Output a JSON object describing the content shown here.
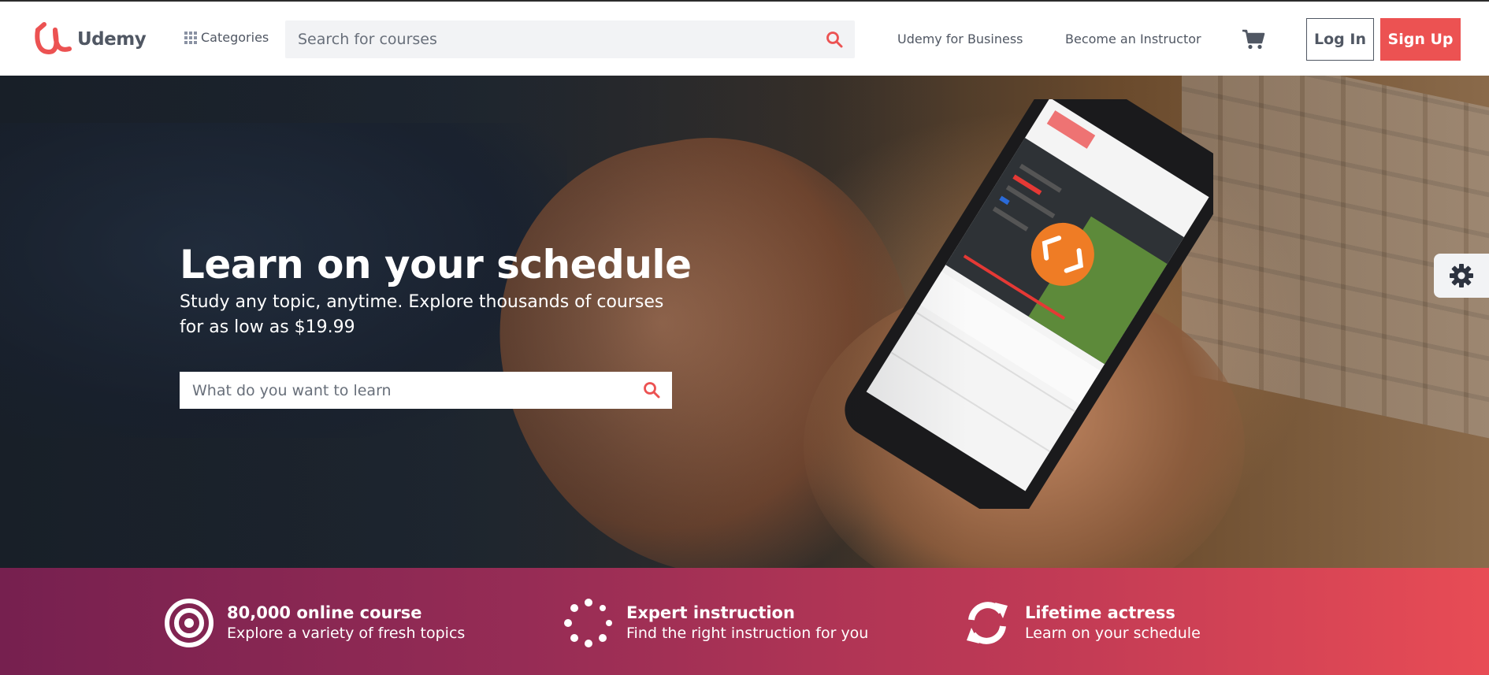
{
  "brand": {
    "name": "Udemy",
    "color": "#ec5252"
  },
  "header": {
    "categories_label": "Categories",
    "search_placeholder": "Search for courses",
    "business_link": "Udemy for Business",
    "instructor_link": "Become an Instructor",
    "login_label": "Log In",
    "signup_label": "Sign Up",
    "icons": [
      "grid-icon",
      "search-icon",
      "cart-icon"
    ]
  },
  "hero": {
    "title": "Learn on your schedule",
    "subtitle": "Study any topic, anytime. Explore thousands of courses for as low as $19.99",
    "search_placeholder": "What do you want to learn"
  },
  "settings_tab": {
    "icon": "gear-icon"
  },
  "features": [
    {
      "icon": "target-icon",
      "title": "80,000 online course",
      "text": "Explore a variety of fresh topics"
    },
    {
      "icon": "loading-dots-icon",
      "title": "Expert instruction",
      "text": "Find the right instruction for you"
    },
    {
      "icon": "refresh-icon",
      "title": "Lifetime actress",
      "text": "Learn on your schedule"
    }
  ],
  "colors": {
    "accent": "#ec5252",
    "text": "#505763",
    "band_start": "#76204f",
    "band_end": "#e84c55"
  }
}
